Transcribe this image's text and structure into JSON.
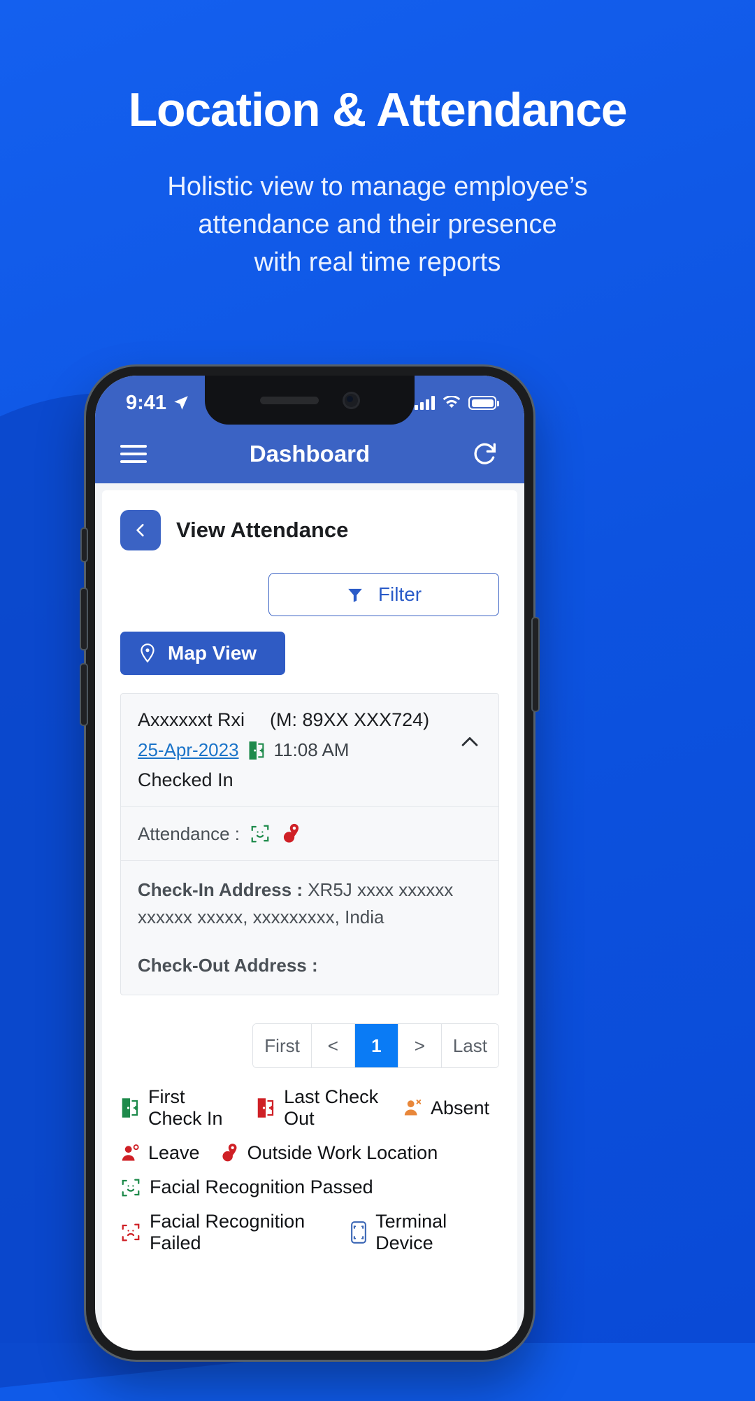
{
  "hero": {
    "title": "Location & Attendance",
    "subtitle": "Holistic view to manage employee’s\nattendance and their presence\nwith real time reports"
  },
  "colors": {
    "background": "#0d53e0",
    "app_bar": "#3b63c4",
    "primary": "#2f5bc4",
    "link": "#1a73c8",
    "active_page": "#0a7bf5",
    "green": "#1e8a4b",
    "red": "#cf2026",
    "orange": "#e8873a",
    "terminal_blue": "#3a66b5"
  },
  "phone": {
    "status_bar": {
      "time": "9:41",
      "location_icon": "location-arrow-icon",
      "signal_icon": "cellular-bars-icon",
      "wifi_icon": "wifi-icon",
      "battery_icon": "battery-full-icon"
    },
    "app_bar": {
      "menu_icon": "hamburger-menu-icon",
      "title": "Dashboard",
      "refresh_icon": "refresh-icon"
    },
    "page": {
      "back_icon": "chevron-left-icon",
      "title": "View Attendance",
      "filter": {
        "label": "Filter",
        "icon": "funnel-filter-icon"
      },
      "map_view": {
        "label": "Map View",
        "icon": "map-pin-icon"
      }
    },
    "record": {
      "name": "Axxxxxxt Rxi",
      "mobile": "(M: 89XX XXX724)",
      "date": "25-Apr-2023",
      "check_in_icon": "door-enter-green-icon",
      "time": "11:08 AM",
      "status": "Checked In",
      "collapse_icon": "chevron-up-icon",
      "attendance_label": "Attendance :",
      "attendance_icons": [
        "face-scan-passed-icon",
        "outside-location-pin-icon"
      ],
      "check_in_address_label": "Check-In Address :",
      "check_in_address": "XR5J xxxx xxxxxx xxxxxx xxxxx, xxxxxxxxx, India",
      "check_out_address_label": "Check-Out Address :",
      "check_out_address": ""
    },
    "pagination": {
      "first": "First",
      "prev": "<",
      "current": "1",
      "next": ">",
      "last": "Last"
    },
    "legend": [
      [
        {
          "icon": "door-enter-green-icon",
          "label": "First Check In"
        },
        {
          "icon": "door-exit-red-icon",
          "label": "Last Check Out"
        },
        {
          "icon": "person-absent-orange-icon",
          "label": "Absent"
        }
      ],
      [
        {
          "icon": "person-leave-red-icon",
          "label": "Leave"
        },
        {
          "icon": "outside-location-pin-icon",
          "label": "Outside Work Location"
        }
      ],
      [
        {
          "icon": "face-scan-passed-icon",
          "label": "Facial Recognition Passed"
        }
      ],
      [
        {
          "icon": "face-scan-failed-icon",
          "label": "Facial Recognition Failed"
        },
        {
          "icon": "terminal-device-icon",
          "label": "Terminal Device"
        }
      ]
    ]
  }
}
